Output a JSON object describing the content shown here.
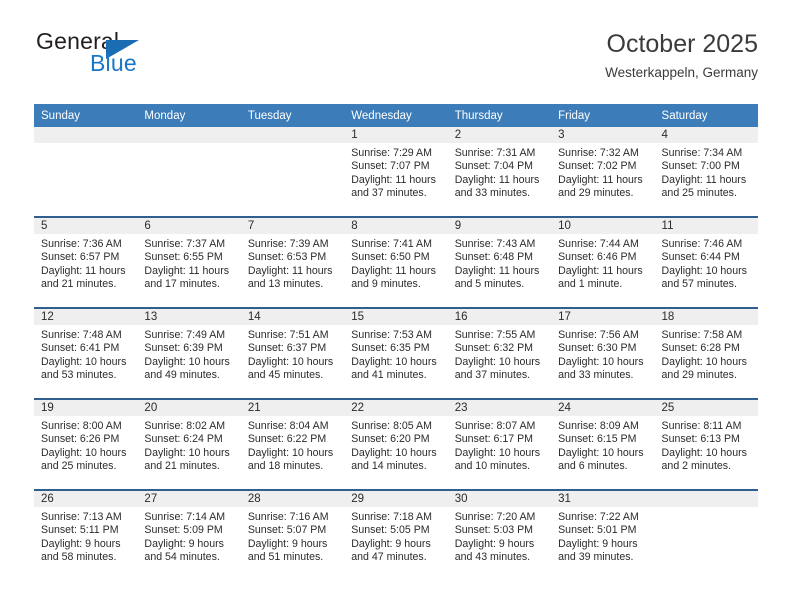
{
  "brand": {
    "name_top": "General",
    "name_bottom": "Blue",
    "triangle_icon": "triangle-icon",
    "color_top": "#231f20",
    "color_bottom": "#1877c9"
  },
  "header": {
    "title": "October 2025",
    "subtitle": "Westerkappeln, Germany"
  },
  "theme": {
    "header_bg": "#3c7cb9",
    "header_text": "#ffffff",
    "row_divider": "#2f5f8f",
    "daynum_band": "#efefef"
  },
  "weekdays": [
    "Sunday",
    "Monday",
    "Tuesday",
    "Wednesday",
    "Thursday",
    "Friday",
    "Saturday"
  ],
  "weeks": [
    [
      {
        "day": "",
        "sunrise": "",
        "sunset": "",
        "daylight1": "",
        "daylight2": ""
      },
      {
        "day": "",
        "sunrise": "",
        "sunset": "",
        "daylight1": "",
        "daylight2": ""
      },
      {
        "day": "",
        "sunrise": "",
        "sunset": "",
        "daylight1": "",
        "daylight2": ""
      },
      {
        "day": "1",
        "sunrise": "Sunrise: 7:29 AM",
        "sunset": "Sunset: 7:07 PM",
        "daylight1": "Daylight: 11 hours",
        "daylight2": "and 37 minutes."
      },
      {
        "day": "2",
        "sunrise": "Sunrise: 7:31 AM",
        "sunset": "Sunset: 7:04 PM",
        "daylight1": "Daylight: 11 hours",
        "daylight2": "and 33 minutes."
      },
      {
        "day": "3",
        "sunrise": "Sunrise: 7:32 AM",
        "sunset": "Sunset: 7:02 PM",
        "daylight1": "Daylight: 11 hours",
        "daylight2": "and 29 minutes."
      },
      {
        "day": "4",
        "sunrise": "Sunrise: 7:34 AM",
        "sunset": "Sunset: 7:00 PM",
        "daylight1": "Daylight: 11 hours",
        "daylight2": "and 25 minutes."
      }
    ],
    [
      {
        "day": "5",
        "sunrise": "Sunrise: 7:36 AM",
        "sunset": "Sunset: 6:57 PM",
        "daylight1": "Daylight: 11 hours",
        "daylight2": "and 21 minutes."
      },
      {
        "day": "6",
        "sunrise": "Sunrise: 7:37 AM",
        "sunset": "Sunset: 6:55 PM",
        "daylight1": "Daylight: 11 hours",
        "daylight2": "and 17 minutes."
      },
      {
        "day": "7",
        "sunrise": "Sunrise: 7:39 AM",
        "sunset": "Sunset: 6:53 PM",
        "daylight1": "Daylight: 11 hours",
        "daylight2": "and 13 minutes."
      },
      {
        "day": "8",
        "sunrise": "Sunrise: 7:41 AM",
        "sunset": "Sunset: 6:50 PM",
        "daylight1": "Daylight: 11 hours",
        "daylight2": "and 9 minutes."
      },
      {
        "day": "9",
        "sunrise": "Sunrise: 7:43 AM",
        "sunset": "Sunset: 6:48 PM",
        "daylight1": "Daylight: 11 hours",
        "daylight2": "and 5 minutes."
      },
      {
        "day": "10",
        "sunrise": "Sunrise: 7:44 AM",
        "sunset": "Sunset: 6:46 PM",
        "daylight1": "Daylight: 11 hours",
        "daylight2": "and 1 minute."
      },
      {
        "day": "11",
        "sunrise": "Sunrise: 7:46 AM",
        "sunset": "Sunset: 6:44 PM",
        "daylight1": "Daylight: 10 hours",
        "daylight2": "and 57 minutes."
      }
    ],
    [
      {
        "day": "12",
        "sunrise": "Sunrise: 7:48 AM",
        "sunset": "Sunset: 6:41 PM",
        "daylight1": "Daylight: 10 hours",
        "daylight2": "and 53 minutes."
      },
      {
        "day": "13",
        "sunrise": "Sunrise: 7:49 AM",
        "sunset": "Sunset: 6:39 PM",
        "daylight1": "Daylight: 10 hours",
        "daylight2": "and 49 minutes."
      },
      {
        "day": "14",
        "sunrise": "Sunrise: 7:51 AM",
        "sunset": "Sunset: 6:37 PM",
        "daylight1": "Daylight: 10 hours",
        "daylight2": "and 45 minutes."
      },
      {
        "day": "15",
        "sunrise": "Sunrise: 7:53 AM",
        "sunset": "Sunset: 6:35 PM",
        "daylight1": "Daylight: 10 hours",
        "daylight2": "and 41 minutes."
      },
      {
        "day": "16",
        "sunrise": "Sunrise: 7:55 AM",
        "sunset": "Sunset: 6:32 PM",
        "daylight1": "Daylight: 10 hours",
        "daylight2": "and 37 minutes."
      },
      {
        "day": "17",
        "sunrise": "Sunrise: 7:56 AM",
        "sunset": "Sunset: 6:30 PM",
        "daylight1": "Daylight: 10 hours",
        "daylight2": "and 33 minutes."
      },
      {
        "day": "18",
        "sunrise": "Sunrise: 7:58 AM",
        "sunset": "Sunset: 6:28 PM",
        "daylight1": "Daylight: 10 hours",
        "daylight2": "and 29 minutes."
      }
    ],
    [
      {
        "day": "19",
        "sunrise": "Sunrise: 8:00 AM",
        "sunset": "Sunset: 6:26 PM",
        "daylight1": "Daylight: 10 hours",
        "daylight2": "and 25 minutes."
      },
      {
        "day": "20",
        "sunrise": "Sunrise: 8:02 AM",
        "sunset": "Sunset: 6:24 PM",
        "daylight1": "Daylight: 10 hours",
        "daylight2": "and 21 minutes."
      },
      {
        "day": "21",
        "sunrise": "Sunrise: 8:04 AM",
        "sunset": "Sunset: 6:22 PM",
        "daylight1": "Daylight: 10 hours",
        "daylight2": "and 18 minutes."
      },
      {
        "day": "22",
        "sunrise": "Sunrise: 8:05 AM",
        "sunset": "Sunset: 6:20 PM",
        "daylight1": "Daylight: 10 hours",
        "daylight2": "and 14 minutes."
      },
      {
        "day": "23",
        "sunrise": "Sunrise: 8:07 AM",
        "sunset": "Sunset: 6:17 PM",
        "daylight1": "Daylight: 10 hours",
        "daylight2": "and 10 minutes."
      },
      {
        "day": "24",
        "sunrise": "Sunrise: 8:09 AM",
        "sunset": "Sunset: 6:15 PM",
        "daylight1": "Daylight: 10 hours",
        "daylight2": "and 6 minutes."
      },
      {
        "day": "25",
        "sunrise": "Sunrise: 8:11 AM",
        "sunset": "Sunset: 6:13 PM",
        "daylight1": "Daylight: 10 hours",
        "daylight2": "and 2 minutes."
      }
    ],
    [
      {
        "day": "26",
        "sunrise": "Sunrise: 7:13 AM",
        "sunset": "Sunset: 5:11 PM",
        "daylight1": "Daylight: 9 hours",
        "daylight2": "and 58 minutes."
      },
      {
        "day": "27",
        "sunrise": "Sunrise: 7:14 AM",
        "sunset": "Sunset: 5:09 PM",
        "daylight1": "Daylight: 9 hours",
        "daylight2": "and 54 minutes."
      },
      {
        "day": "28",
        "sunrise": "Sunrise: 7:16 AM",
        "sunset": "Sunset: 5:07 PM",
        "daylight1": "Daylight: 9 hours",
        "daylight2": "and 51 minutes."
      },
      {
        "day": "29",
        "sunrise": "Sunrise: 7:18 AM",
        "sunset": "Sunset: 5:05 PM",
        "daylight1": "Daylight: 9 hours",
        "daylight2": "and 47 minutes."
      },
      {
        "day": "30",
        "sunrise": "Sunrise: 7:20 AM",
        "sunset": "Sunset: 5:03 PM",
        "daylight1": "Daylight: 9 hours",
        "daylight2": "and 43 minutes."
      },
      {
        "day": "31",
        "sunrise": "Sunrise: 7:22 AM",
        "sunset": "Sunset: 5:01 PM",
        "daylight1": "Daylight: 9 hours",
        "daylight2": "and 39 minutes."
      },
      {
        "day": "",
        "sunrise": "",
        "sunset": "",
        "daylight1": "",
        "daylight2": ""
      }
    ]
  ]
}
